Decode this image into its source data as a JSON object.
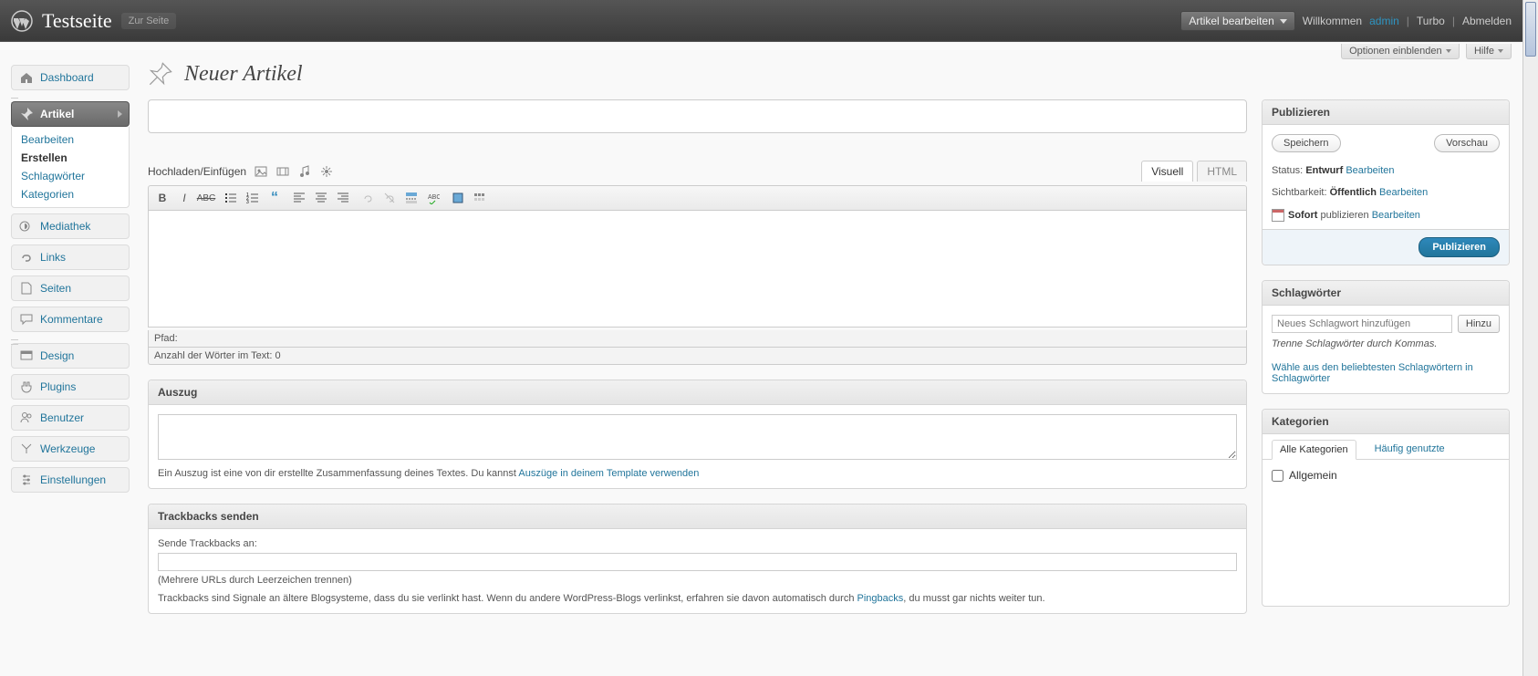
{
  "header": {
    "site_title": "Testseite",
    "view_site": "Zur Seite",
    "favorite_action": "Artikel bearbeiten",
    "welcome": "Willkommen",
    "user": "admin",
    "turbo": "Turbo",
    "logout": "Abmelden"
  },
  "screen_meta": {
    "options": "Optionen einblenden",
    "help": "Hilfe"
  },
  "page": {
    "title": "Neuer Artikel"
  },
  "menu": {
    "dashboard": "Dashboard",
    "artikel": "Artikel",
    "artikel_sub": {
      "bearbeiten": "Bearbeiten",
      "erstellen": "Erstellen",
      "schlagworter": "Schlagwörter",
      "kategorien": "Kategorien"
    },
    "mediathek": "Mediathek",
    "links": "Links",
    "seiten": "Seiten",
    "kommentare": "Kommentare",
    "design": "Design",
    "plugins": "Plugins",
    "benutzer": "Benutzer",
    "werkzeuge": "Werkzeuge",
    "einstellungen": "Einstellungen"
  },
  "editor": {
    "media_label": "Hochladen/Einfügen",
    "tab_visual": "Visuell",
    "tab_html": "HTML",
    "path_label": "Pfad:",
    "wordcount": "Anzahl der Wörter im Text: 0"
  },
  "excerpt": {
    "heading": "Auszug",
    "hint_pre": "Ein Auszug ist eine von dir erstellte Zusammenfassung deines Textes. Du kannst ",
    "hint_link": "Auszüge in deinem Template verwenden"
  },
  "trackbacks": {
    "heading": "Trackbacks senden",
    "send_to": "Sende Trackbacks an:",
    "multi": "(Mehrere URLs durch Leerzeichen trennen)",
    "desc_pre": "Trackbacks sind Signale an ältere Blogsysteme, dass du sie verlinkt hast. Wenn du andere WordPress-Blogs verlinkst, erfahren sie davon automatisch durch ",
    "desc_link": "Pingbacks",
    "desc_post": ", du musst gar nichts weiter tun."
  },
  "publish": {
    "heading": "Publizieren",
    "save": "Speichern",
    "preview": "Vorschau",
    "status_label": "Status:",
    "status_value": "Entwurf",
    "edit": "Bearbeiten",
    "visibility_label": "Sichtbarkeit:",
    "visibility_value": "Öffentlich",
    "schedule_pre": "Sofort",
    "schedule_post": "publizieren",
    "publish_btn": "Publizieren"
  },
  "tags": {
    "heading": "Schlagwörter",
    "placeholder": "Neues Schlagwort hinzufügen",
    "add": "Hinzu",
    "hint": "Trenne Schlagwörter durch Kommas.",
    "popular": "Wähle aus den beliebtesten Schlagwörtern in Schlagwörter"
  },
  "categories": {
    "heading": "Kategorien",
    "tab_all": "Alle Kategorien",
    "tab_popular": "Häufig genutzte",
    "item1": "Allgemein"
  }
}
